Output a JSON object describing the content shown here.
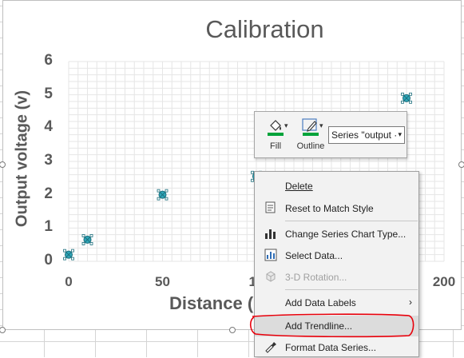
{
  "chart_data": {
    "type": "scatter",
    "title": "Calibration",
    "xlabel": "Distance (",
    "ylabel": "Output voltage (v)",
    "x_ticks": [
      "0",
      "50",
      "10",
      "200"
    ],
    "y_ticks": [
      "0",
      "1",
      "2",
      "3",
      "4",
      "5",
      "6"
    ],
    "xlim": [
      0,
      200
    ],
    "ylim": [
      0,
      6
    ],
    "grid": true,
    "marker_color": "#2ea6b8",
    "series": [
      {
        "x": [
          0,
          10,
          50,
          100,
          180
        ],
        "y": [
          0.2,
          0.65,
          2.0,
          2.55,
          4.9
        ]
      }
    ]
  },
  "mini_toolbar": {
    "fill_label": "Fill",
    "outline_label": "Outline",
    "series_selector_value": "Series \"output ·",
    "icons": {
      "fill": "paint-bucket-icon",
      "outline": "pen-outline-icon"
    },
    "swatch_color": "#00a33a"
  },
  "context_menu": {
    "items": [
      {
        "label": "Delete",
        "underline": "D",
        "icon": "",
        "disabled": false
      },
      {
        "label": "Reset to Match Style",
        "underline": "",
        "icon": "reset-style-icon",
        "disabled": false
      },
      {
        "label": "Change Series Chart Type...",
        "underline": "",
        "icon": "chart-type-icon",
        "disabled": false
      },
      {
        "label": "Select Data...",
        "underline": "",
        "icon": "select-data-icon",
        "disabled": false
      },
      {
        "label": "3-D Rotation...",
        "underline": "",
        "icon": "cube-icon",
        "disabled": true
      },
      {
        "label": "Add Data Labels",
        "underline": "",
        "icon": "",
        "disabled": false,
        "submenu": true
      },
      {
        "label": "Add Trendline...",
        "underline": "",
        "icon": "",
        "disabled": false,
        "highlighted": true
      },
      {
        "label": "Format Data Series...",
        "underline": "",
        "icon": "format-brush-icon",
        "disabled": false
      }
    ],
    "submenu_arrow": "›"
  },
  "annotation_color": "#e8000b"
}
